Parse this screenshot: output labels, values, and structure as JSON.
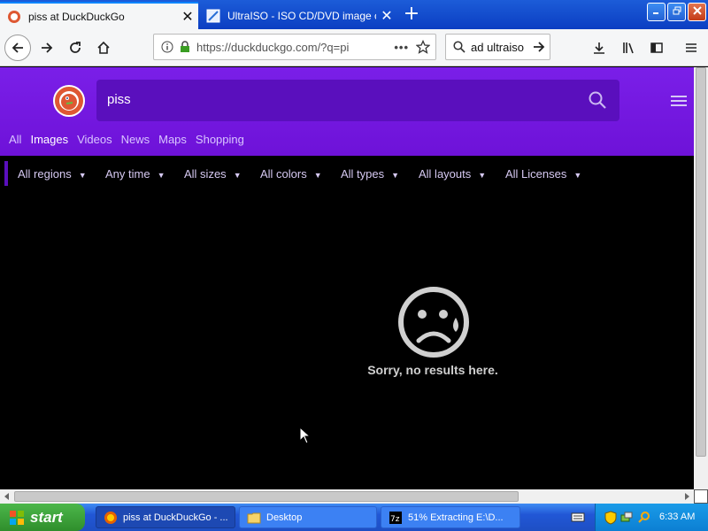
{
  "browser": {
    "tabs": [
      {
        "title": "piss at DuckDuckGo",
        "active": true,
        "favicon": "duckduckgo-icon"
      },
      {
        "title": "UltraISO - ISO CD/DVD image crea",
        "active": false,
        "favicon": "ultraiso-icon"
      }
    ],
    "new_tab_glyph": "+",
    "close_glyph": "✕",
    "url": "https://duckduckgo.com/?q=pi",
    "search_value": "ad ultraiso",
    "page_actions_glyph": "•••"
  },
  "ddg": {
    "query": "piss",
    "tabs": [
      {
        "label": "All",
        "active": false
      },
      {
        "label": "Images",
        "active": true
      },
      {
        "label": "Videos",
        "active": false
      },
      {
        "label": "News",
        "active": false
      },
      {
        "label": "Maps",
        "active": false
      },
      {
        "label": "Shopping",
        "active": false
      }
    ],
    "filters": [
      "All regions",
      "Any time",
      "All sizes",
      "All colors",
      "All types",
      "All layouts",
      "All Licenses"
    ],
    "empty_message": "Sorry, no results here.",
    "accent_color": "#7a1fe8"
  },
  "taskbar": {
    "start_label": "start",
    "tasks": [
      {
        "label": "piss at DuckDuckGo - ...",
        "icon": "firefox-icon",
        "active": true
      },
      {
        "label": "Desktop",
        "icon": "folder-icon",
        "active": false
      },
      {
        "label": "51% Extracting E:\\D...",
        "icon": "7zip-icon",
        "active": false
      }
    ],
    "clock": "6:33 AM"
  }
}
